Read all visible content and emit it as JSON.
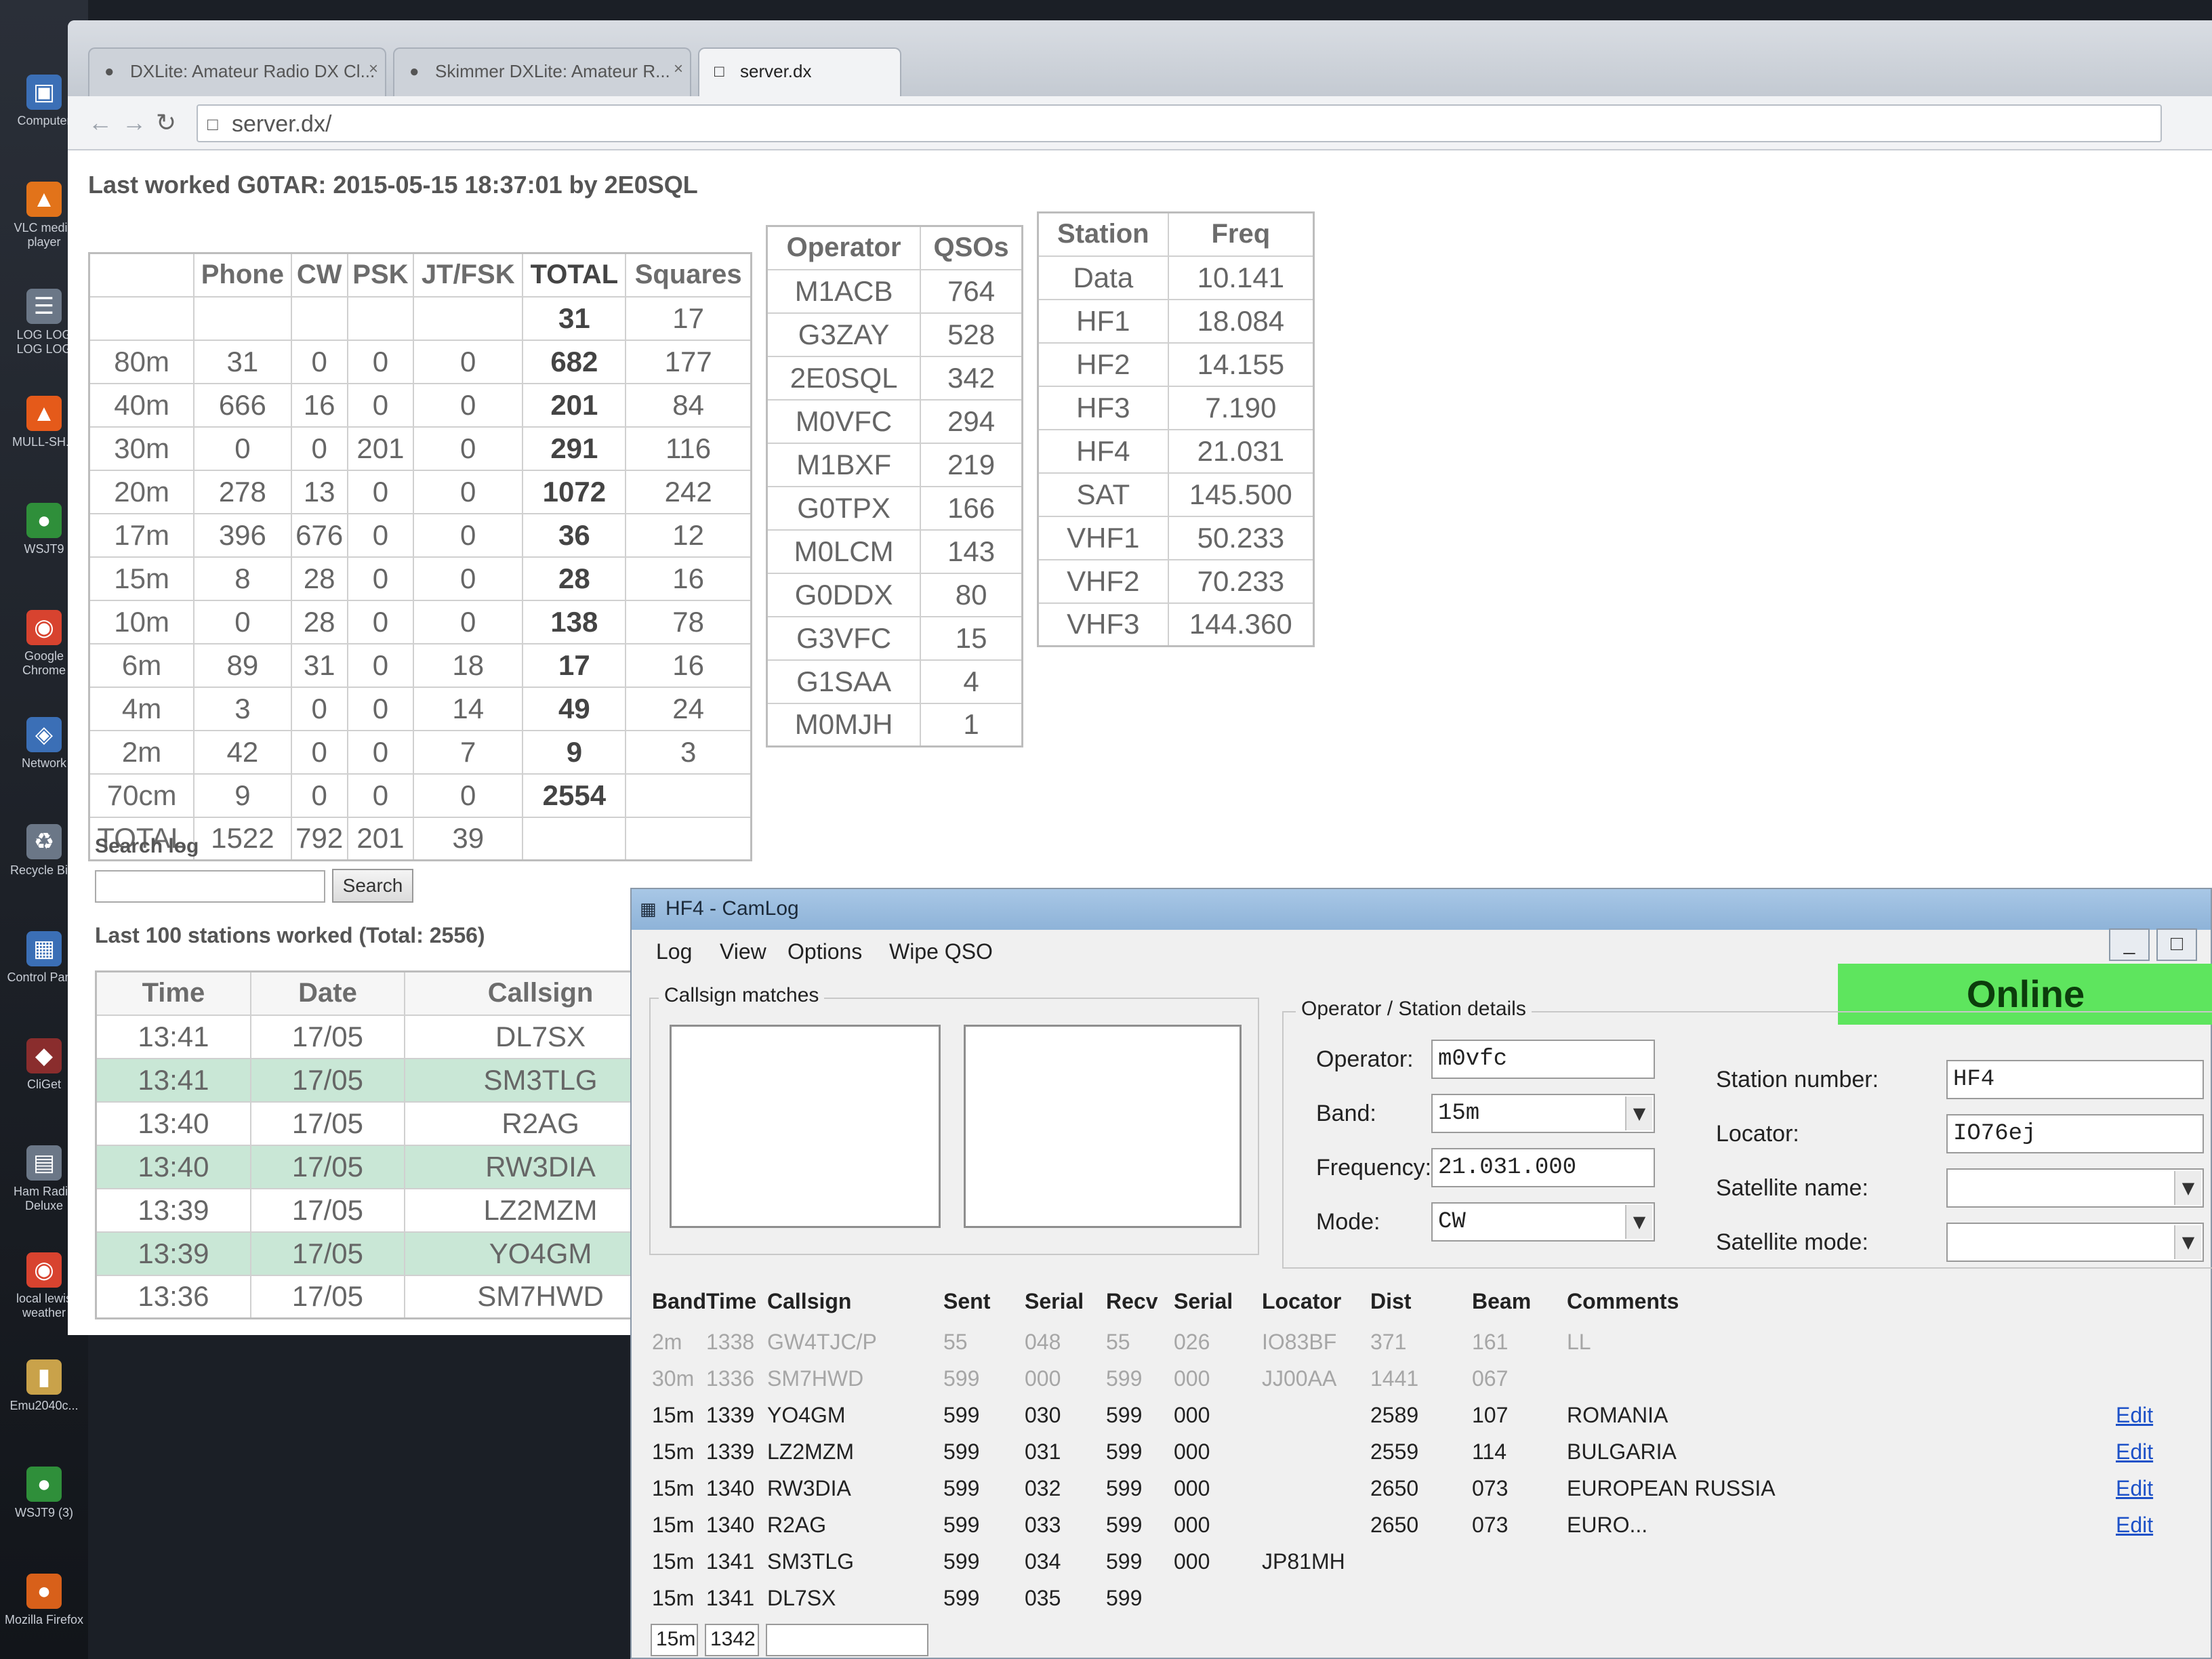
{
  "desktop": {
    "icons": [
      {
        "name": "computer",
        "label": "Computer",
        "icon": "computer-icon",
        "glyph": "▣",
        "color": "#3b6fb6"
      },
      {
        "name": "vlc",
        "label": "VLC media player",
        "icon": "vlc-icon",
        "glyph": "▲",
        "color": "#e2731a"
      },
      {
        "name": "loglog",
        "label": "LOG LOG LOG LOG",
        "icon": "document-icon",
        "glyph": "☰",
        "color": "#6b7787"
      },
      {
        "name": "mull",
        "label": "MULL-SH...",
        "icon": "cone-icon",
        "glyph": "▲",
        "color": "#e55a1a"
      },
      {
        "name": "wsjt9",
        "label": "WSJT9",
        "icon": "globe-icon",
        "glyph": "●",
        "color": "#2f8f3a"
      },
      {
        "name": "chrome",
        "label": "Google Chrome",
        "icon": "chrome-icon",
        "glyph": "◉",
        "color": "#d8432f"
      },
      {
        "name": "network",
        "label": "Network",
        "icon": "network-icon",
        "glyph": "◈",
        "color": "#3b6fb6"
      },
      {
        "name": "recycle",
        "label": "Recycle Bi...",
        "icon": "recycle-bin-icon",
        "glyph": "♻",
        "color": "#6b7787"
      },
      {
        "name": "control",
        "label": "Control Panel",
        "icon": "control-panel-icon",
        "glyph": "▦",
        "color": "#3b6fb6"
      },
      {
        "name": "clicket",
        "label": "CliGet",
        "icon": "app-icon",
        "glyph": "◆",
        "color": "#8a2d2d"
      },
      {
        "name": "hrd",
        "label": "Ham Radio Deluxe",
        "icon": "radio-icon",
        "glyph": "▤",
        "color": "#6b7787"
      },
      {
        "name": "weather",
        "label": "local lewis weather",
        "icon": "weather-icon",
        "glyph": "◉",
        "color": "#d8432f"
      },
      {
        "name": "emu",
        "label": "Emu2040c...",
        "icon": "folder-icon",
        "glyph": "▮",
        "color": "#c9a24a"
      },
      {
        "name": "wsjt93",
        "label": "WSJT9 (3)",
        "icon": "globe-icon",
        "glyph": "●",
        "color": "#2f8f3a"
      },
      {
        "name": "firefox",
        "label": "Mozilla Firefox",
        "icon": "firefox-icon",
        "glyph": "●",
        "color": "#d8601a"
      }
    ]
  },
  "browser": {
    "tabs": [
      {
        "label": "DXLite: Amateur Radio DX Cl...",
        "active": false
      },
      {
        "label": "Skimmer DXLite: Amateur R...",
        "active": false
      },
      {
        "label": "server.dx",
        "active": true
      }
    ],
    "close_glyph": "×",
    "url": "server.dx/"
  },
  "page": {
    "last_worked": "Last worked G0TAR: 2015-05-15 18:37:01 by 2E0SQL",
    "band_table": {
      "headers": [
        "",
        "Phone",
        "CW",
        "PSK",
        "JT/FSK",
        "TOTAL",
        "Squares"
      ],
      "rows": [
        [
          "",
          "",
          "",
          "",
          "",
          "31",
          "17"
        ],
        [
          "80m",
          "31",
          "0",
          "0",
          "0",
          "682",
          "177"
        ],
        [
          "40m",
          "666",
          "16",
          "0",
          "0",
          "201",
          "84"
        ],
        [
          "30m",
          "0",
          "0",
          "201",
          "0",
          "291",
          "116"
        ],
        [
          "20m",
          "278",
          "13",
          "0",
          "0",
          "1072",
          "242"
        ],
        [
          "17m",
          "396",
          "676",
          "0",
          "0",
          "36",
          "12"
        ],
        [
          "15m",
          "8",
          "28",
          "0",
          "0",
          "28",
          "16"
        ],
        [
          "10m",
          "0",
          "28",
          "0",
          "0",
          "138",
          "78"
        ],
        [
          "6m",
          "89",
          "31",
          "0",
          "18",
          "17",
          "16"
        ],
        [
          "4m",
          "3",
          "0",
          "0",
          "14",
          "49",
          "24"
        ],
        [
          "2m",
          "42",
          "0",
          "0",
          "7",
          "9",
          "3"
        ],
        [
          "70cm",
          "9",
          "0",
          "0",
          "0",
          "2554",
          ""
        ],
        [
          "TOTAL",
          "1522",
          "792",
          "201",
          "39",
          "",
          ""
        ]
      ]
    },
    "operator_table": {
      "headers": [
        "Operator",
        "QSOs"
      ],
      "rows": [
        [
          "M1ACB",
          "764"
        ],
        [
          "G3ZAY",
          "528"
        ],
        [
          "2E0SQL",
          "342"
        ],
        [
          "M0VFC",
          "294"
        ],
        [
          "M1BXF",
          "219"
        ],
        [
          "G0TPX",
          "166"
        ],
        [
          "M0LCM",
          "143"
        ],
        [
          "G0DDX",
          "80"
        ],
        [
          "G3VFC",
          "15"
        ],
        [
          "G1SAA",
          "4"
        ],
        [
          "M0MJH",
          "1"
        ]
      ]
    },
    "station_table": {
      "headers": [
        "Station",
        "Freq"
      ],
      "rows": [
        [
          "Data",
          "10.141"
        ],
        [
          "HF1",
          "18.084"
        ],
        [
          "HF2",
          "14.155"
        ],
        [
          "HF3",
          "7.190"
        ],
        [
          "HF4",
          "21.031"
        ],
        [
          "SAT",
          "145.500"
        ],
        [
          "VHF1",
          "50.233"
        ],
        [
          "VHF2",
          "70.233"
        ],
        [
          "VHF3",
          "144.360"
        ]
      ]
    },
    "search": {
      "label": "Search log",
      "button": "Search",
      "value": ""
    },
    "last100": "Last 100 stations worked (Total: 2556)",
    "recent_table": {
      "headers": [
        "Time",
        "Date",
        "Callsign"
      ],
      "rows": [
        [
          "13:41",
          "17/05",
          "DL7SX"
        ],
        [
          "13:41",
          "17/05",
          "SM3TLG"
        ],
        [
          "13:40",
          "17/05",
          "R2AG"
        ],
        [
          "13:40",
          "17/05",
          "RW3DIA"
        ],
        [
          "13:39",
          "17/05",
          "LZ2MZM"
        ],
        [
          "13:39",
          "17/05",
          "YO4GM"
        ],
        [
          "13:36",
          "17/05",
          "SM7HWD"
        ]
      ]
    }
  },
  "camlog": {
    "title": "HF4 - CamLog",
    "window_buttons": {
      "minimize": "_",
      "maximize": "□"
    },
    "menu": [
      "Log",
      "View",
      "Options",
      "Wipe QSO"
    ],
    "status": "Online",
    "callsign_matches_label": "Callsign matches",
    "details": {
      "group_label": "Operator / Station details",
      "operator_label": "Operator:",
      "operator_value": "m0vfc",
      "band_label": "Band:",
      "band_value": "15m",
      "frequency_label": "Frequency:",
      "frequency_value": "21.031.000",
      "mode_label": "Mode:",
      "mode_value": "CW",
      "station_number_label": "Station number:",
      "station_number_value": "HF4",
      "locator_label": "Locator:",
      "locator_value": "IO76ej",
      "satellite_name_label": "Satellite name:",
      "satellite_name_value": "",
      "satellite_mode_label": "Satellite mode:",
      "satellite_mode_value": "",
      "dropdown_glyph": "▼"
    },
    "log": {
      "headers": [
        "Band",
        "Time",
        "Callsign",
        "Sent",
        "Serial",
        "Recv",
        "Serial",
        "Locator",
        "Dist",
        "Beam",
        "Comments"
      ],
      "rows": [
        {
          "band": "2m",
          "time": "1338",
          "call": "GW4TJC/P",
          "sent": "55",
          "serial": "048",
          "recv": "55",
          "rserial": "026",
          "locator": "IO83BF",
          "dist": "371",
          "beam": "161",
          "comments": "LL",
          "edit": "",
          "faint": true
        },
        {
          "band": "30m",
          "time": "1336",
          "call": "SM7HWD",
          "sent": "599",
          "serial": "000",
          "recv": "599",
          "rserial": "000",
          "locator": "JJ00AA",
          "dist": "1441",
          "beam": "067",
          "comments": "",
          "edit": "",
          "faint": true
        },
        {
          "band": "15m",
          "time": "1339",
          "call": "YO4GM",
          "sent": "599",
          "serial": "030",
          "recv": "599",
          "rserial": "000",
          "locator": "",
          "dist": "2589",
          "beam": "107",
          "comments": "ROMANIA",
          "edit": "Edit",
          "faint": false
        },
        {
          "band": "15m",
          "time": "1339",
          "call": "LZ2MZM",
          "sent": "599",
          "serial": "031",
          "recv": "599",
          "rserial": "000",
          "locator": "",
          "dist": "2559",
          "beam": "114",
          "comments": "BULGARIA",
          "edit": "Edit",
          "faint": false
        },
        {
          "band": "15m",
          "time": "1340",
          "call": "RW3DIA",
          "sent": "599",
          "serial": "032",
          "recv": "599",
          "rserial": "000",
          "locator": "",
          "dist": "2650",
          "beam": "073",
          "comments": "EUROPEAN RUSSIA",
          "edit": "Edit",
          "faint": false
        },
        {
          "band": "15m",
          "time": "1340",
          "call": "R2AG",
          "sent": "599",
          "serial": "033",
          "recv": "599",
          "rserial": "000",
          "locator": "",
          "dist": "2650",
          "beam": "073",
          "comments": "EURO...",
          "edit": "Edit",
          "faint": false
        },
        {
          "band": "15m",
          "time": "1341",
          "call": "SM3TLG",
          "sent": "599",
          "serial": "034",
          "recv": "599",
          "rserial": "000",
          "locator": "JP81MH",
          "dist": "",
          "beam": "",
          "comments": "",
          "edit": "",
          "faint": false
        },
        {
          "band": "15m",
          "time": "1341",
          "call": "DL7SX",
          "sent": "599",
          "serial": "035",
          "recv": "599",
          "rserial": "",
          "locator": "",
          "dist": "",
          "beam": "",
          "comments": "",
          "edit": "",
          "faint": false
        }
      ],
      "new_entry": {
        "band": "15m",
        "time": "1342",
        "call": ""
      }
    }
  }
}
